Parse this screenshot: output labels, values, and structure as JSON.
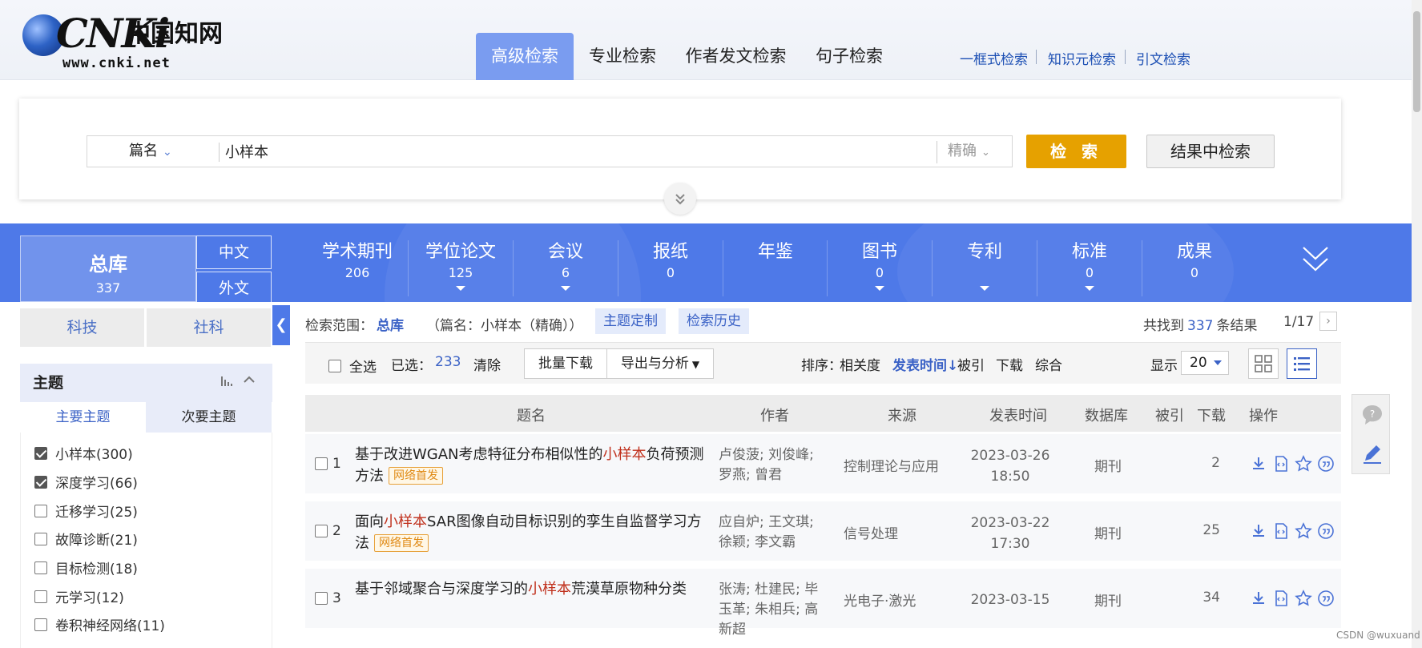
{
  "logo": {
    "mark": "CNKi",
    "cn_name": "中国知网",
    "url": "www.cnki.net"
  },
  "header": {
    "tabs": [
      {
        "label": "高级检索",
        "active": true
      },
      {
        "label": "专业检索",
        "active": false
      },
      {
        "label": "作者发文检索",
        "active": false
      },
      {
        "label": "句子检索",
        "active": false
      }
    ],
    "links": [
      "一框式检索",
      "知识元检索",
      "引文检索"
    ]
  },
  "search": {
    "field": "篇名",
    "query": "小样本",
    "match": "精确",
    "search_label": "检 索",
    "within_label": "结果中检索"
  },
  "databases": {
    "total": {
      "label": "总库",
      "count": "337"
    },
    "lang_zh": "中文",
    "lang_en": "外文",
    "items": [
      {
        "name": "学术期刊",
        "count": "206"
      },
      {
        "name": "学位论文",
        "count": "125"
      },
      {
        "name": "会议",
        "count": "6"
      },
      {
        "name": "报纸",
        "count": "0"
      },
      {
        "name": "年鉴",
        "count": ""
      },
      {
        "name": "图书",
        "count": "0"
      },
      {
        "name": "专利",
        "count": ""
      },
      {
        "name": "标准",
        "count": "0"
      },
      {
        "name": "成果",
        "count": "0"
      }
    ]
  },
  "sidebar": {
    "tabs": [
      "科技",
      "社科"
    ],
    "group_title": "主题",
    "subtabs": [
      "主要主题",
      "次要主题"
    ],
    "facets": [
      {
        "label": "小样本(300)",
        "checked": true
      },
      {
        "label": "深度学习(66)",
        "checked": true
      },
      {
        "label": "迁移学习(25)",
        "checked": false
      },
      {
        "label": "故障诊断(21)",
        "checked": false
      },
      {
        "label": "目标检测(18)",
        "checked": false
      },
      {
        "label": "元学习(12)",
        "checked": false
      },
      {
        "label": "卷积神经网络(11)",
        "checked": false
      }
    ]
  },
  "results": {
    "scope_label": "检索范围：",
    "scope_db": "总库",
    "scope_query": "（篇名：小样本（精确））",
    "topic_custom": "主题定制",
    "search_history": "检索历史",
    "found_prefix": "共找到",
    "found_count": "337",
    "found_suffix": "条结果",
    "page": "1/17",
    "toolbar": {
      "select_all": "全选",
      "selected_label": "已选：",
      "selected_count": "233",
      "clear": "清除",
      "batch_download": "批量下载",
      "export": "导出与分析",
      "sort_label": "排序：",
      "sort_options": [
        {
          "label": "相关度",
          "active": false
        },
        {
          "label": "发表时间↓",
          "active": true
        },
        {
          "label": "被引",
          "active": false
        },
        {
          "label": "下载",
          "active": false
        },
        {
          "label": "综合",
          "active": false
        }
      ],
      "show_label": "显示",
      "page_size": "20"
    },
    "columns": [
      "题名",
      "作者",
      "来源",
      "发表时间",
      "数据库",
      "被引",
      "下载",
      "操作"
    ],
    "rows": [
      {
        "num": "1",
        "title_pre": "基于改进WGAN考虑特征分布相似性的",
        "title_hl": "小样本",
        "title_post": "负荷预测方法",
        "badge": "网络首发",
        "authors": "卢俊菠; 刘俊峰; 罗燕; 曾君",
        "source": "控制理论与应用",
        "date": "2023-03-26",
        "time": "18:50",
        "db": "期刊",
        "downloads": "2"
      },
      {
        "num": "2",
        "title_pre": "面向",
        "title_hl": "小样本",
        "title_post": "SAR图像自动目标识别的孪生自监督学习方法",
        "badge": "网络首发",
        "authors": "应自炉; 王文琪; 徐颖; 李文霸",
        "source": "信号处理",
        "date": "2023-03-22",
        "time": "17:30",
        "db": "期刊",
        "downloads": "25"
      },
      {
        "num": "3",
        "title_pre": "基于邻域聚合与深度学习的",
        "title_hl": "小样本",
        "title_post": "荒漠草原物种分类",
        "badge": "",
        "authors": "张涛; 杜建民; 毕玉革; 朱相兵; 高新超",
        "source": "光电子·激光",
        "date": "2023-03-15",
        "time": "",
        "db": "期刊",
        "downloads": "34"
      }
    ]
  },
  "watermark": "CSDN @wuxuand",
  "colors": {
    "brand_blue": "#4e79e8",
    "accent_orange": "#e6a100",
    "highlight_red": "#c0301c",
    "link_blue": "#3b62c6"
  }
}
